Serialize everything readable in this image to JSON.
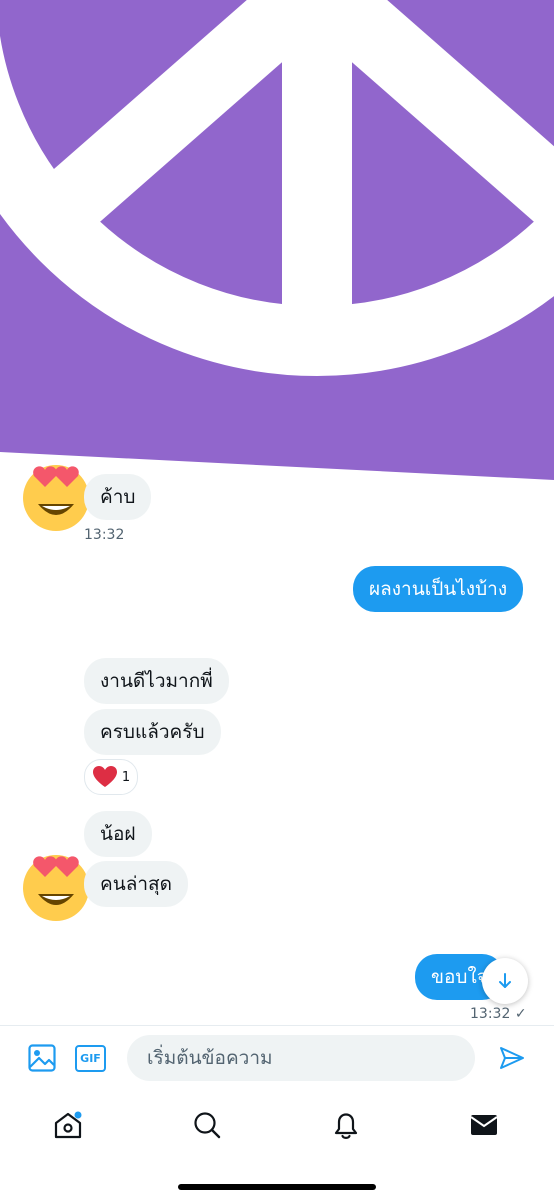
{
  "conversation": {
    "messages": [
      {
        "sender": "other",
        "text": "ค้าบ",
        "time": "13:32"
      },
      {
        "sender": "me",
        "text": "ผลงานเป็นไงบ้าง"
      },
      {
        "sender": "other",
        "text": "งานดีไวมากพี่"
      },
      {
        "sender": "other",
        "text": "ครบแล้วครับ",
        "reaction": {
          "emoji": "heart",
          "count": "1"
        }
      },
      {
        "sender": "other",
        "text": "น้อฝ"
      },
      {
        "sender": "other",
        "text": "คนล่าสุด"
      },
      {
        "sender": "me",
        "text": "ขอบใจ",
        "time": "13:32",
        "status": "✓"
      }
    ]
  },
  "composer": {
    "placeholder": "เริ่มต้นข้อความ",
    "gif_label": "GIF"
  },
  "colors": {
    "accent": "#1d9bf0",
    "image_background": "#9166cc",
    "incoming_bubble": "#eff3f4"
  },
  "icons": {
    "hero": "peace-sign-icon",
    "avatar": "heart-eyes-emoji-icon",
    "reaction": "red-heart-icon",
    "scroll": "arrow-down-icon",
    "media": "image-icon",
    "send": "send-icon",
    "tabs": [
      "home-icon",
      "search-icon",
      "bell-icon",
      "mail-icon"
    ]
  }
}
